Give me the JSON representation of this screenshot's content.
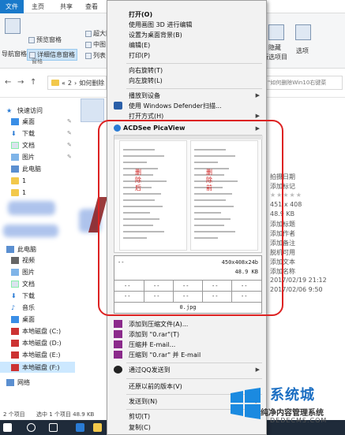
{
  "window": {
    "ribbon_tabs": [
      "文件",
      "主页",
      "共享",
      "查看"
    ],
    "ribbon_items": {
      "preview_pane": "预览窗格",
      "details_pane": "详细信息窗格",
      "nav_pane": "导航窗格",
      "pane_group": "窗格",
      "xlarge_icons": "超大图",
      "medium_icons": "中图",
      "list": "列表",
      "hide": "隐藏",
      "hide_selected": "所选项目",
      "options": "选项"
    },
    "address_crumb": "2",
    "address_folder": "如何删除",
    "search_placeholder": "\"如何删除Win10右键菜",
    "nav_items": [
      "快速访问",
      "桌面",
      "下载",
      "文档",
      "图片",
      "此电脑",
      "1",
      "1",
      "此电脑",
      "视频",
      "图片",
      "文档",
      "下载",
      "音乐",
      "桌面",
      "本地磁盘 (C:)",
      "本地磁盘 (D:)",
      "本地磁盘 (E:)",
      "本地磁盘 (F:)",
      "网络"
    ],
    "details": [
      "拍摄日期",
      "添加标记",
      "★★★★★",
      "451 x 408",
      "48.9 KB",
      "添加标题",
      "添加作者",
      "添加备注",
      "脱机可用",
      "添加文本",
      "添加名称",
      "2017/02/19 21:12",
      "2017/02/06 9:50"
    ],
    "status": {
      "count": "2 个项目",
      "selected": "选中 1 个项目  48.9 KB"
    }
  },
  "context_menu": {
    "open": "打开(O)",
    "edit_3d": "使用画图 3D 进行编辑",
    "set_bg": "设置为桌面背景(B)",
    "edit": "编辑(E)",
    "print": "打印(P)",
    "rotate_right": "向右旋转(T)",
    "rotate_left": "向左旋转(L)",
    "cast": "播放到设备",
    "defender": "使用 Windows Defender扫描...",
    "open_with": "打开方式(H)",
    "acdsee": "ACDSee PicaView",
    "preview_label_left": "删除后",
    "preview_label_right": "删除前",
    "info_line1_left": "--",
    "info_line1_right": "450x408x24b",
    "info_line2_right": "48.9 KB",
    "info_cells": "--",
    "info_filename": "0.jpg",
    "add_archive": "添加到压缩文件(A)...",
    "add_rar": "添加到 \"0.rar\"(T)",
    "compress_email": "压缩并 E-mail...",
    "compress_rar_email": "压缩到 \"0.rar\" 并 E-mail",
    "qq_send": "通过QQ发送到",
    "restore": "还原以前的版本(V)",
    "send_to": "发送到(N)",
    "cut": "剪切(T)",
    "copy": "复制(C)"
  },
  "watermark": {
    "brand": "系统城",
    "tagline": "纯净内容管理系统",
    "url": "DEDECMS.COM"
  },
  "colors": {
    "accent": "#1979ca",
    "highlight_ring": "#d22222",
    "taskbar": "#1f2b3a"
  }
}
